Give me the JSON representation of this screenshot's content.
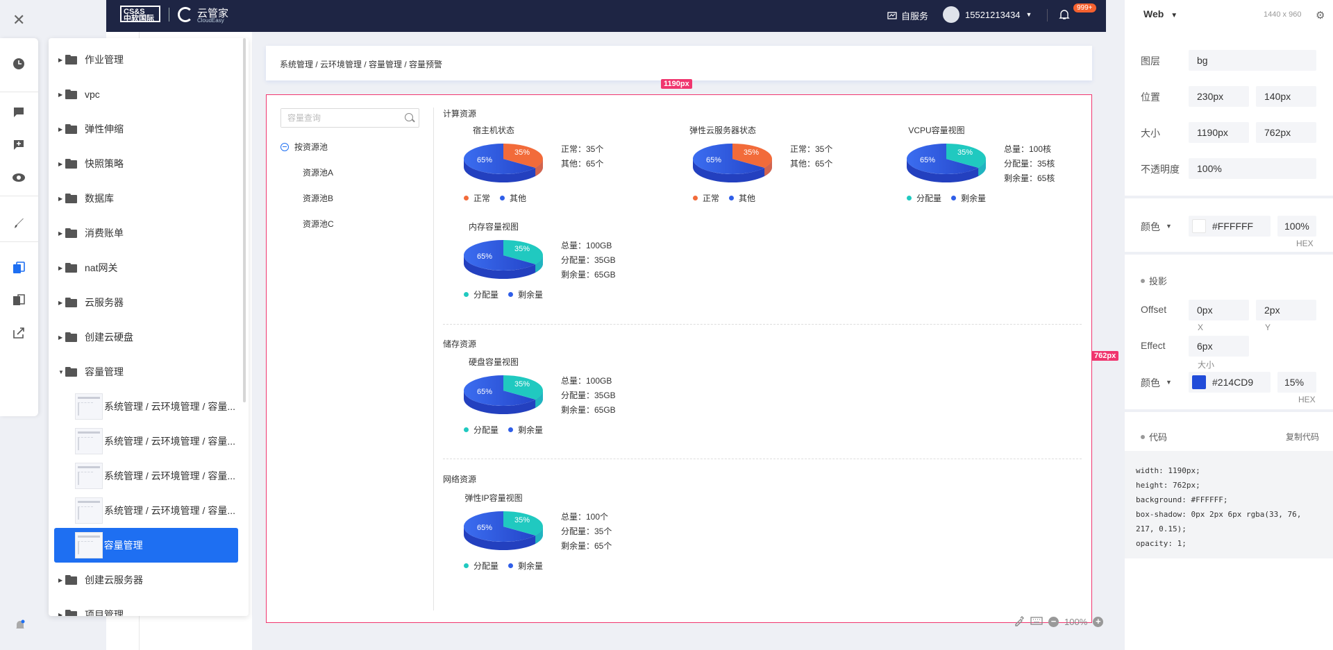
{
  "rail": {
    "icons": [
      "close-icon",
      "clock-icon",
      "comment-icon",
      "add-comment-icon",
      "eye-icon",
      "brush-icon",
      "layers-icon",
      "cards-icon",
      "export-icon",
      "notification-icon"
    ]
  },
  "layers": {
    "folders_top": [
      "作业管理",
      "vpc",
      "弹性伸缩",
      "快照策略",
      "数据库",
      "消费账单",
      "nat网关",
      "云服务器",
      "创建云硬盘"
    ],
    "expanded_folder": "容量管理",
    "leaves": [
      "系统管理 / 云环境管理 / 容量...",
      "系统管理 / 云环境管理 / 容量...",
      "系统管理 / 云环境管理 / 容量...",
      "系统管理 / 云环境管理 / 容量..."
    ],
    "active_leaf": "容量管理",
    "folders_bottom": [
      "创建云服务器",
      "项目管理"
    ]
  },
  "topbar": {
    "logo_line1": "CS&S",
    "logo_line2": "中软国际",
    "brand_cn": "云管家",
    "brand_en": "CloudEasy",
    "self_service": "自服务",
    "username": "15521213434",
    "badge": "999+"
  },
  "breadcrumb": "系统管理 / 云环境管理 / 容量管理 / 容量预警",
  "measure": {
    "width_tag": "1190px",
    "height_tag": "762px"
  },
  "search": {
    "placeholder": "容量查询"
  },
  "pool_tree": {
    "root": "按资源池",
    "items": [
      "资源池A",
      "资源池B",
      "资源池C"
    ]
  },
  "sections": {
    "compute": "计算资源",
    "storage": "储存资源",
    "network": "网络资源"
  },
  "widgets": [
    {
      "title": "宿主机状态",
      "pct_big": "65%",
      "pct_small": "35%",
      "small_color": "#f26b3a",
      "legend": [
        "正常",
        "其他"
      ],
      "legend_colors": [
        "#f26b3a",
        "#2f5ee8"
      ],
      "stats": [
        "正常：35个",
        "其他：65个"
      ]
    },
    {
      "title": "弹性云服务器状态",
      "pct_big": "65%",
      "pct_small": "35%",
      "small_color": "#f26b3a",
      "legend": [
        "正常",
        "其他"
      ],
      "legend_colors": [
        "#f26b3a",
        "#2f5ee8"
      ],
      "stats": [
        "正常：35个",
        "其他：65个"
      ]
    },
    {
      "title": "VCPU容量视图",
      "pct_big": "65%",
      "pct_small": "35%",
      "small_color": "#20c9c0",
      "legend": [
        "分配量",
        "剩余量"
      ],
      "legend_colors": [
        "#20c9c0",
        "#2f5ee8"
      ],
      "stats": [
        "总量：100核",
        "分配量：35核",
        "剩余量：65核"
      ]
    },
    {
      "title": "内存容量视图",
      "pct_big": "65%",
      "pct_small": "35%",
      "small_color": "#20c9c0",
      "legend": [
        "分配量",
        "剩余量"
      ],
      "legend_colors": [
        "#20c9c0",
        "#2f5ee8"
      ],
      "stats": [
        "总量：100GB",
        "分配量：35GB",
        "剩余量：65GB"
      ]
    },
    {
      "title": "硬盘容量视图",
      "pct_big": "65%",
      "pct_small": "35%",
      "small_color": "#20c9c0",
      "legend": [
        "分配量",
        "剩余量"
      ],
      "legend_colors": [
        "#20c9c0",
        "#2f5ee8"
      ],
      "stats": [
        "总量：100GB",
        "分配量：35GB",
        "剩余量：65GB"
      ]
    },
    {
      "title": "弹性IP容量视图",
      "pct_big": "65%",
      "pct_small": "35%",
      "small_color": "#20c9c0",
      "legend": [
        "分配量",
        "剩余量"
      ],
      "legend_colors": [
        "#20c9c0",
        "#2f5ee8"
      ],
      "stats": [
        "总量：100个",
        "分配量：35个",
        "剩余量：65个"
      ]
    }
  ],
  "canvas_zoom": "100%",
  "inspector": {
    "device": "Web",
    "size": "1440 x 960",
    "layer_label": "图层",
    "layer_value": "bg",
    "position_label": "位置",
    "pos_x": "230px",
    "pos_y": "140px",
    "size_label": "大小",
    "w": "1190px",
    "h": "762px",
    "opacity_label": "不透明度",
    "opacity": "100%",
    "color_label": "颜色",
    "fill_hex": "#FFFFFF",
    "fill_opacity": "100%",
    "hex_label": "HEX",
    "shadow_label": "投影",
    "offset_label": "Offset",
    "offset_x": "0px",
    "offset_y": "2px",
    "x_label": "X",
    "y_label": "Y",
    "effect_label": "Effect",
    "effect_value": "6px",
    "effect_sub": "大小",
    "shadow_color_label": "颜色",
    "shadow_hex": "#214CD9",
    "shadow_opacity": "15%",
    "shadow_hex_label": "HEX",
    "code_label": "代码",
    "copy_label": "复制代码",
    "code_lines": [
      "width: 1190px;",
      "height: 762px;",
      "background: #FFFFFF;",
      "box-shadow: 0px 2px 6px rgba(33, 76, 217, 0.15);",
      "opacity: 1;"
    ],
    "colors": {
      "fill": "#FFFFFF",
      "shadow": "#214CD9"
    }
  }
}
